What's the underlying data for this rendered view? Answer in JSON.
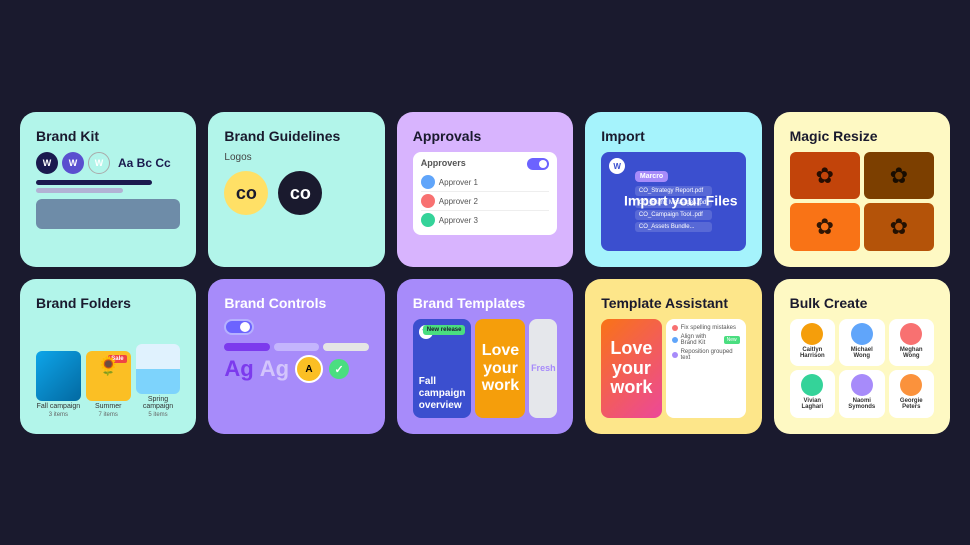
{
  "cards": {
    "brand_kit": {
      "title": "Brand Kit",
      "text_sample": "Aa Bc Cc"
    },
    "brand_guidelines": {
      "title": "Brand Guidelines",
      "subtitle": "Logos"
    },
    "approvals": {
      "title": "Approvals",
      "approvers_label": "Approvers",
      "toggle_on": true
    },
    "import": {
      "title": "Import",
      "badge": "Marcro",
      "import_text": "Import your Files",
      "files": [
        "CO_Strategy Report.pdf",
        "CO_Brand Messages..pdf",
        "CO_Campaign Tool..pdf",
        "CO_Assets Bundle..."
      ]
    },
    "magic_resize": {
      "title": "Magic Resize"
    },
    "brand_folders": {
      "title": "Brand Folders",
      "folders": [
        {
          "label": "Fall campaign",
          "count": "3 items"
        },
        {
          "label": "Summer",
          "count": "7 items"
        },
        {
          "label": "Spring campaign",
          "count": "5 items"
        }
      ]
    },
    "brand_controls": {
      "title": "Brand Controls",
      "ag_purple": "Ag",
      "ag_white": "Ag"
    },
    "brand_templates": {
      "title": "Brand Templates",
      "template1_title": "Fall campaign overview",
      "template1_badge": "New release",
      "template2_text": "Love your work",
      "template3_text": "Fresh"
    },
    "template_assistant": {
      "title": "Template Assistant",
      "main_text": "Love your work",
      "checks": [
        {
          "text": "Fix spelling mistakes",
          "badge": ""
        },
        {
          "text": "Align with Brand Kit",
          "badge": "New"
        },
        {
          "text": "Reposition grouped text items",
          "badge": ""
        }
      ]
    },
    "bulk_create": {
      "title": "Bulk Create",
      "people": [
        {
          "name": "Caitlyn Harrison",
          "color": "#f59e0b"
        },
        {
          "name": "Michael Wong",
          "color": "#60a5fa"
        },
        {
          "name": "Meghan Wong",
          "color": "#f87171"
        },
        {
          "name": "Vivian Laghari",
          "color": "#34d399"
        },
        {
          "name": "Naomi Symonds",
          "color": "#a78bfa"
        },
        {
          "name": "Georgie Peters",
          "color": "#fb923c"
        }
      ]
    }
  }
}
